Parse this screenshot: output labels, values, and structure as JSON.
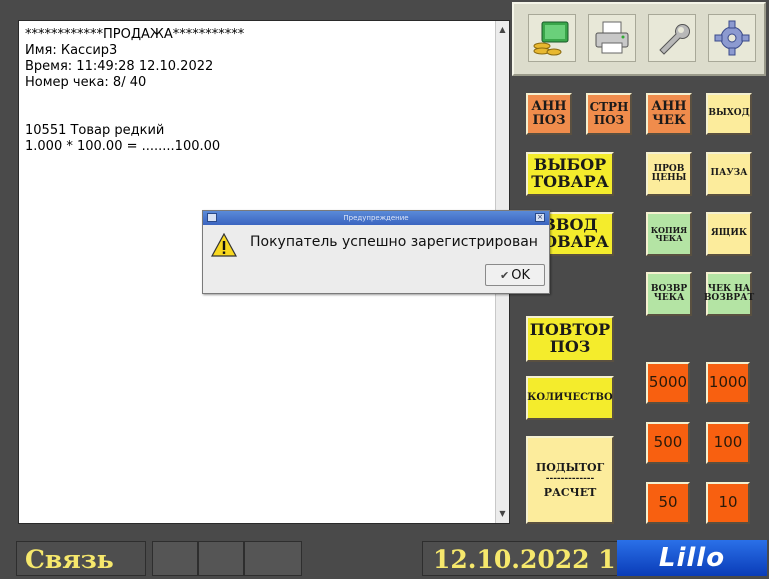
{
  "receipt": {
    "lines": "************ПРОДАЖА***********\nИмя: Кассир3\nВремя: 11:49:28 12.10.2022\nНомер чека: 8/ 40\n\n\n10551 Товар редкий\n1.000 * 100.00 = ........100.00"
  },
  "toolbar": {
    "icons": [
      "money-icon",
      "printer-icon",
      "wrench-icon",
      "gear-icon"
    ]
  },
  "buttons": {
    "ann_pos": "АНН ПОЗ",
    "strn_pos": "СТРН ПОЗ",
    "ann_check": "АНН ЧЕК",
    "exit": "ВЫХОД",
    "select_item": "ВЫБОР ТОВАРА",
    "check_price": "ПРОВ ЦЕНЫ",
    "pause": "ПАУЗА",
    "enter_item": "ВВОД ТОВАРА",
    "copy_check": "КОПИЯ ЧЕКА",
    "drawer": "ЯЩИК",
    "return_check": "ВОЗВР ЧЕКА",
    "return_receipt": "ЧЕК НА ВОЗВРАТ",
    "repeat_pos": "ПОВТОР ПОЗ",
    "quantity": "КОЛИЧЕСТВО",
    "subtotal": "ПОДЫТОГ",
    "subtotal_sep": "-------------",
    "payment": "РАСЧЕТ"
  },
  "cash_buttons": [
    "5000",
    "1000",
    "500",
    "100",
    "50",
    "10"
  ],
  "status": {
    "connection": "Связь",
    "date": "12.10.2022 1",
    "logo": "Lillo"
  },
  "dialog": {
    "title": "Предупреждение",
    "message": "Покупатель успешно зарегистрирован",
    "ok_label": "OK"
  },
  "colors": {
    "background": "#4a4a4a",
    "yellow": "#f4ec2c",
    "pale": "#fcec9c",
    "orange": "#f08c4c",
    "red": "#f86010",
    "green": "#b4e4a4",
    "status_text": "#f6e86c",
    "logo_blue": "#1a50d0"
  }
}
